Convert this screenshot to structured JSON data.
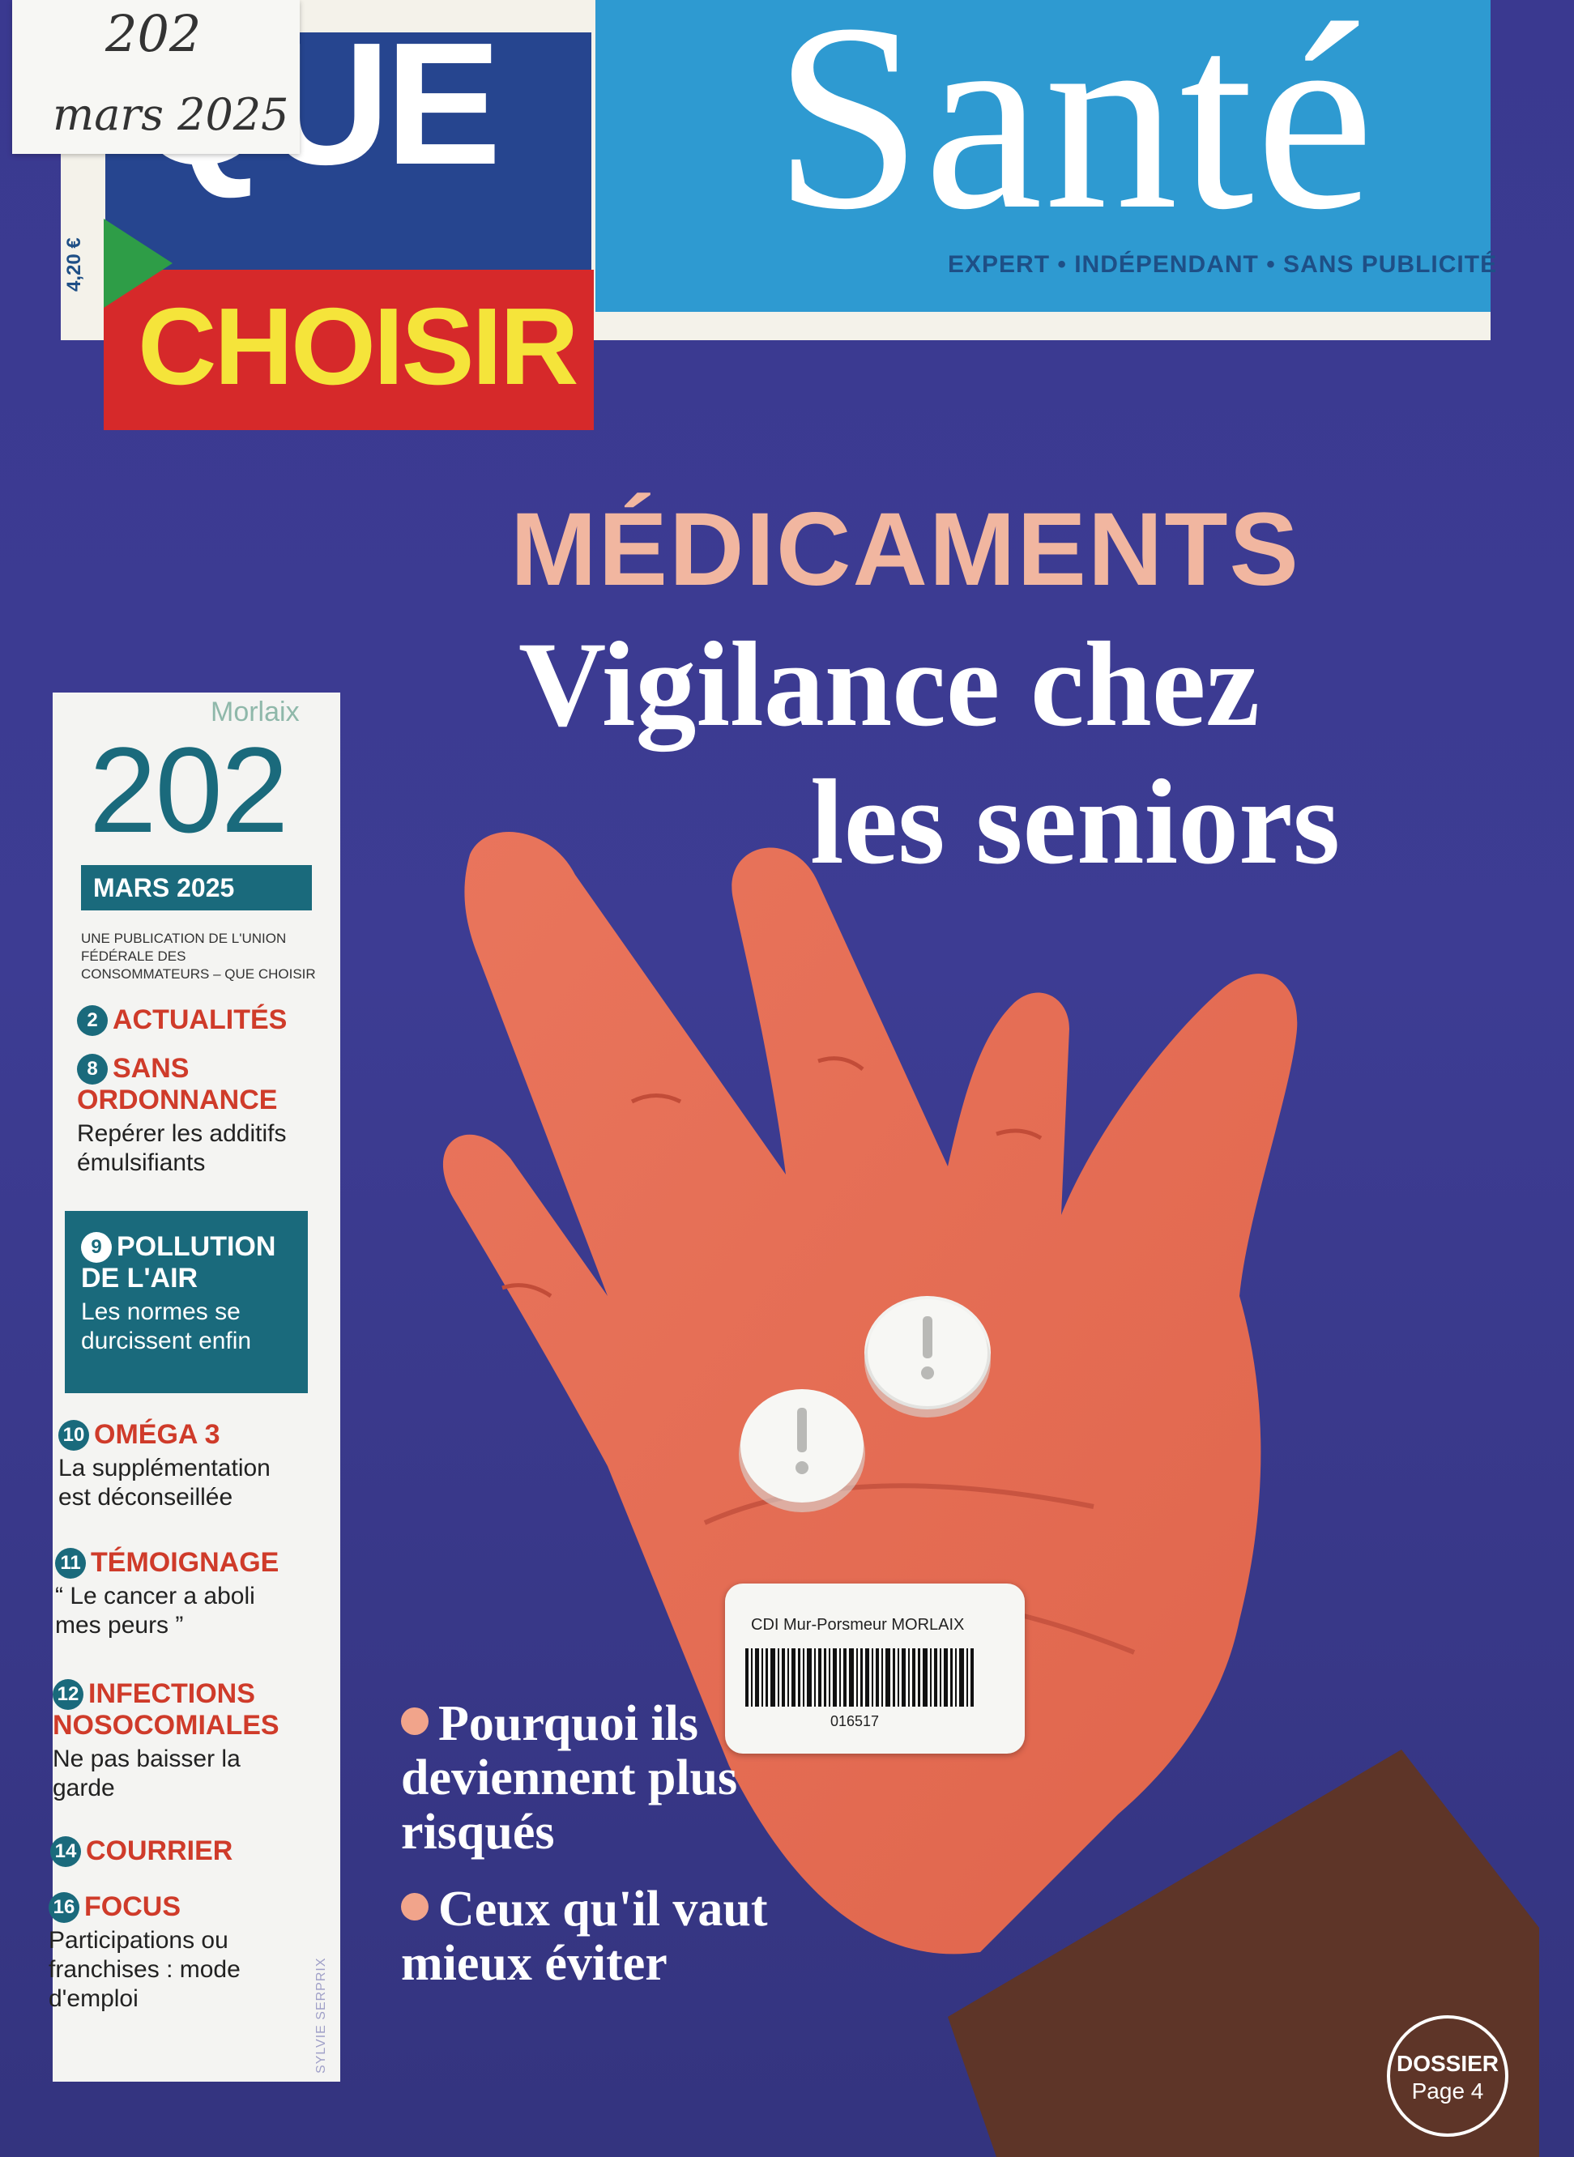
{
  "masthead": {
    "brand_top": "QUE",
    "brand_bottom": "CHOISIR",
    "title": "Santé",
    "tagline": "EXPERT • INDÉPENDANT • SANS PUBLICITÉ",
    "price": "4,20 €"
  },
  "handwritten_sticker": {
    "line1": "202",
    "line2": "mars 2025"
  },
  "headline": {
    "kicker": "MÉDICAMENTS",
    "line1": "Vigilance chez",
    "line2": "les seniors"
  },
  "issue": {
    "location": "Morlaix",
    "number": "202",
    "date": "MARS 2025",
    "publisher": "UNE PUBLICATION DE L'UNION FÉDÉRALE DES CONSOMMATEURS – QUE CHOISIR"
  },
  "toc": [
    {
      "page": "2",
      "title": "ACTUALITÉS",
      "subtitle": ""
    },
    {
      "page": "8",
      "title": "SANS ORDONNANCE",
      "subtitle": "Repérer les additifs émulsifiants"
    },
    {
      "page": "9",
      "title": "POLLUTION DE L'AIR",
      "subtitle": "Les normes se durcissent enfin"
    },
    {
      "page": "10",
      "title": "OMÉGA 3",
      "subtitle": "La supplémentation est déconseillée"
    },
    {
      "page": "11",
      "title": "TÉMOIGNAGE",
      "subtitle": "“ Le cancer a aboli mes peurs ”"
    },
    {
      "page": "12",
      "title": "INFECTIONS NOSOCOMIALES",
      "subtitle": "Ne pas baisser la garde"
    },
    {
      "page": "14",
      "title": "COURRIER",
      "subtitle": ""
    },
    {
      "page": "16",
      "title": "FOCUS",
      "subtitle": "Participations ou franchises : mode d'emploi"
    }
  ],
  "credit": "SYLVIE SERPRIX",
  "bullets": [
    "Pourquoi ils deviennent plus risqués",
    "Ceux qu'il vaut mieux éviter"
  ],
  "barcode_label": {
    "library": "CDI Mur-Porsmeur MORLAIX",
    "code": "016517"
  },
  "dossier_badge": {
    "label": "DOSSIER",
    "page": "Page 4"
  },
  "colors": {
    "background": "#3b3a8e",
    "sante_blue": "#2e9ad1",
    "que_blue": "#26458f",
    "choisir_red": "#d6292a",
    "choisir_yellow": "#f5e43a",
    "accent_pink": "#f1b6a0",
    "toc_teal": "#1a6a7c",
    "toc_red": "#cf3b2a"
  },
  "icons": [
    "exclamation-pill-icon",
    "bullet-dot-icon",
    "barcode-icon"
  ]
}
